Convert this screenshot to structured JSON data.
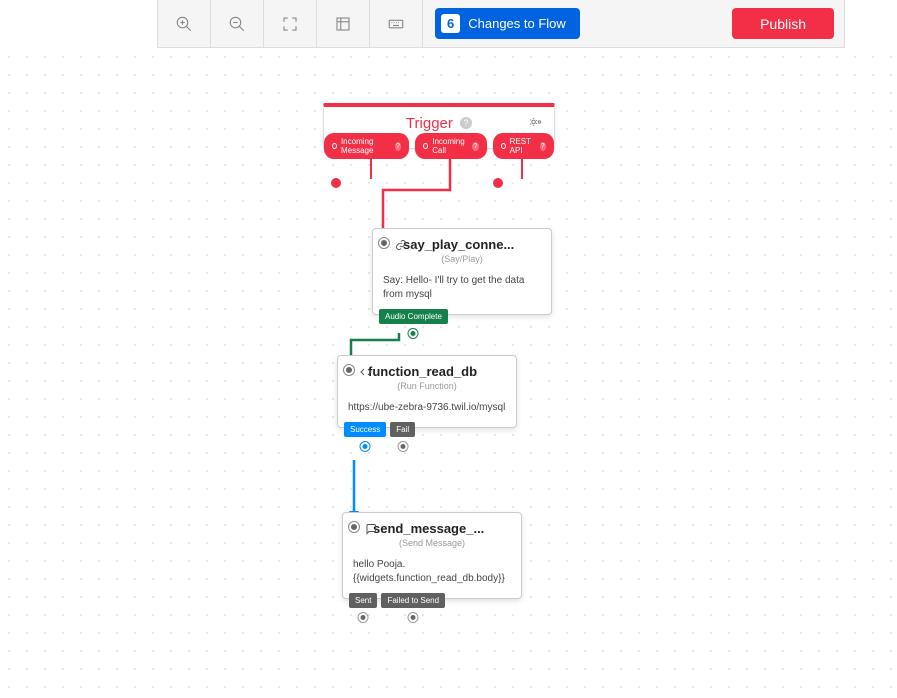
{
  "toolbar": {
    "changes_count": "6",
    "changes_label": "Changes to Flow",
    "publish_label": "Publish"
  },
  "trigger": {
    "title": "Trigger",
    "outputs": {
      "incoming_message": "Incoming Message",
      "incoming_call": "Incoming Call",
      "rest_api": "REST API"
    }
  },
  "widgets": {
    "say_play": {
      "title": "say_play_conne...",
      "type": "(Say/Play)",
      "body": "Say: Hello- I'll try to get the data from mysql",
      "outputs": {
        "audio_complete": "Audio Complete"
      }
    },
    "function_read_db": {
      "title": "function_read_db",
      "type": "(Run Function)",
      "body": "https://ube-zebra-9736.twil.io/mysql",
      "outputs": {
        "success": "Success",
        "fail": "Fail"
      }
    },
    "send_message": {
      "title": "send_message_...",
      "type": "(Send Message)",
      "body": "hello Pooja. {{widgets.function_read_db.body}}",
      "outputs": {
        "sent": "Sent",
        "failed": "Failed to Send"
      }
    }
  }
}
